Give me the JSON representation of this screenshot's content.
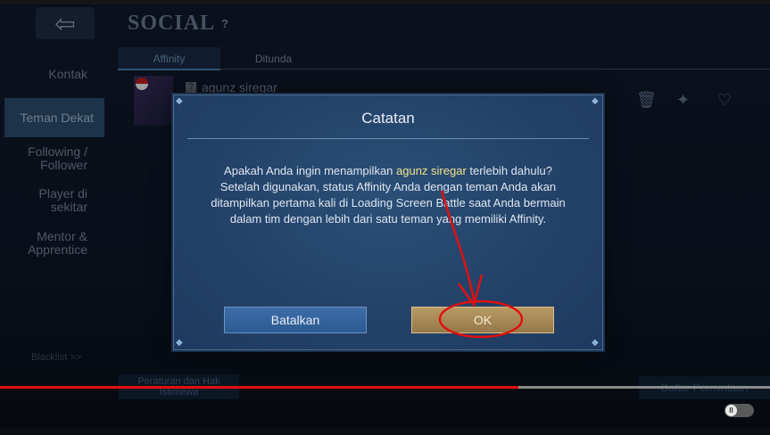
{
  "header": {
    "back_icon": "back-arrow-icon",
    "title": "SOCIAL",
    "help": "?"
  },
  "tabs": [
    {
      "label": "Affinity",
      "active": true
    },
    {
      "label": "Ditunda",
      "active": false
    }
  ],
  "sidebar": {
    "items": [
      {
        "label": "Kontak"
      },
      {
        "label": "Teman Dekat",
        "active": true
      },
      {
        "label": "Following / Follower"
      },
      {
        "label": "Player di sekitar"
      },
      {
        "label": "Mentor & Apprentice"
      }
    ],
    "blacklist": "Blacklist >>"
  },
  "friend": {
    "qmark": "?",
    "name": "agunz siregar"
  },
  "row_icons": [
    "trash-icon",
    "gift-icon",
    "heart-pulse-icon"
  ],
  "footer": {
    "rules": "Peraturan dan Hak Istimewa",
    "requests": "Daftar Permintaan"
  },
  "dialog": {
    "title": "Catatan",
    "message_before": "Apakah Anda ingin menampilkan ",
    "highlight": "agunz siregar",
    "message_after": " terlebih dahulu? Setelah digunakan, status Affinity Anda dengan teman Anda akan ditampilkan pertama kali di Loading Screen Battle saat Anda bermain dalam tim dengan lebih dari satu teman yang memiliki Affinity.",
    "cancel_label": "Batalkan",
    "ok_label": "OK"
  },
  "video": {
    "progress_fraction": 0.673,
    "toggle_glyph": "II"
  },
  "colors": {
    "highlight_text": "#f2e28a",
    "progress": "#e01010",
    "annotation": "#e01010"
  }
}
